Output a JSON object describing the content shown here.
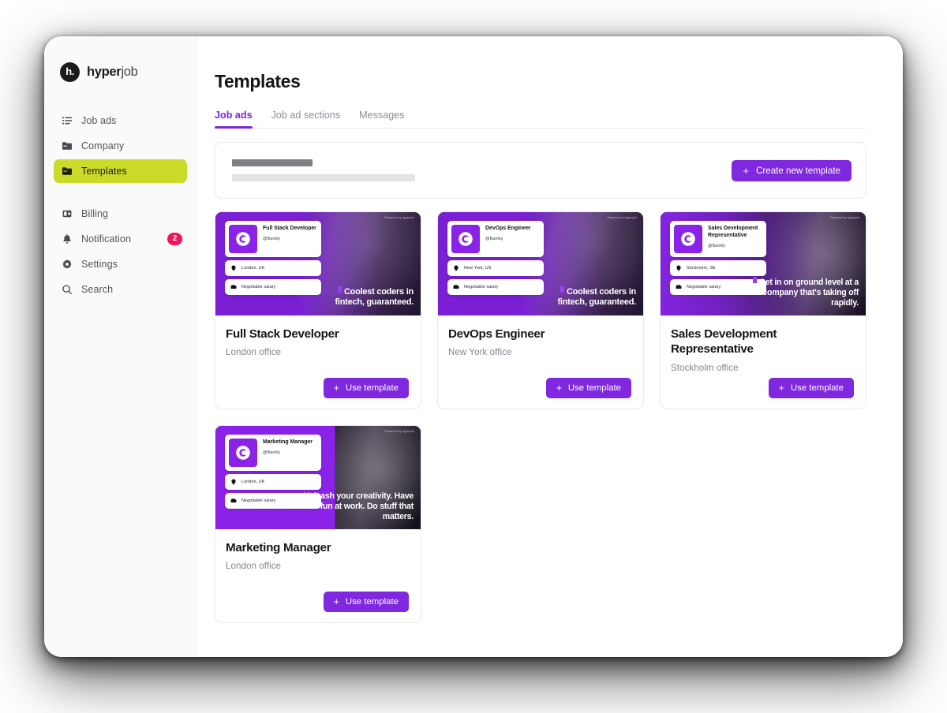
{
  "brand": {
    "mark_text": "h.",
    "name_bold": "hyper",
    "name_light": "job"
  },
  "sidebar": {
    "primary_items": [
      {
        "label": "Job ads",
        "icon": "list-icon",
        "active": false
      },
      {
        "label": "Company",
        "icon": "folder-icon",
        "active": false
      },
      {
        "label": "Templates",
        "icon": "folder-icon",
        "active": true
      }
    ],
    "secondary_items": [
      {
        "label": "Billing",
        "icon": "credit-card-icon",
        "badge": ""
      },
      {
        "label": "Notification",
        "icon": "bell-icon",
        "badge": "2"
      },
      {
        "label": "Settings",
        "icon": "gear-icon",
        "badge": ""
      },
      {
        "label": "Search",
        "icon": "search-icon",
        "badge": ""
      }
    ],
    "active_color": "#cbdb2a",
    "badge_color": "#ef1558"
  },
  "header": {
    "title": "Templates"
  },
  "tabs": [
    {
      "label": "Job ads",
      "active": true
    },
    {
      "label": "Job ad sections",
      "active": false
    },
    {
      "label": "Messages",
      "active": false
    }
  ],
  "tab_accent_color": "#7b25d6",
  "banner": {
    "skeleton_lines": 2,
    "create_button": {
      "label": "Create new template",
      "icon": "plus-icon",
      "color": "#8028df"
    }
  },
  "cards": [
    {
      "title": "Full Stack Developer",
      "office": "London office",
      "use_label": "Use template",
      "preview": {
        "job_title": "Full Stack Developer",
        "company": "@Bankly",
        "location": "London, UK",
        "salary": "Negotiable salary",
        "tagline": "Coolest coders in fintech, guaranteed.",
        "powered_by": "Powered by hyperjob",
        "logo_icon": "bankly-logo-icon",
        "location_icon": "pin-icon",
        "salary_icon": "wallet-icon"
      }
    },
    {
      "title": "DevOps Engineer",
      "office": "New York office",
      "use_label": "Use template",
      "preview": {
        "job_title": "DevOps Engineer",
        "company": "@Bankly",
        "location": "New York, US",
        "salary": "Negotiable salary",
        "tagline": "Coolest coders in fintech, guaranteed.",
        "powered_by": "Powered by hyperjob",
        "logo_icon": "bankly-logo-icon",
        "location_icon": "pin-icon",
        "salary_icon": "wallet-icon"
      }
    },
    {
      "title": "Sales Development Representative",
      "office": "Stockholm office",
      "use_label": "Use template",
      "preview": {
        "job_title": "Sales Development Representative",
        "company": "@Bankly",
        "location": "Stockholm, SE",
        "salary": "Negotiable salary",
        "tagline": "Get in on ground level at a company that's taking off rapidly.",
        "powered_by": "Powered by hyperjob",
        "logo_icon": "bankly-logo-icon",
        "location_icon": "pin-icon",
        "salary_icon": "wallet-icon"
      }
    },
    {
      "title": "Marketing Manager",
      "office": "London office",
      "use_label": "Use template",
      "preview": {
        "job_title": "Marketing Manager",
        "company": "@Bankly",
        "location": "London, UK",
        "salary": "Negotiable salary",
        "tagline": "Unleash your creativity. Have fun at work. Do stuff that matters.",
        "powered_by": "Powered by hyperjob",
        "logo_icon": "bankly-logo-icon",
        "location_icon": "pin-icon",
        "salary_icon": "wallet-icon"
      }
    }
  ],
  "theme": {
    "purple": "#8028df",
    "lime": "#cbdb2a",
    "pink": "#ef1558",
    "text_dark": "#16161a",
    "text_muted": "#85858e"
  }
}
